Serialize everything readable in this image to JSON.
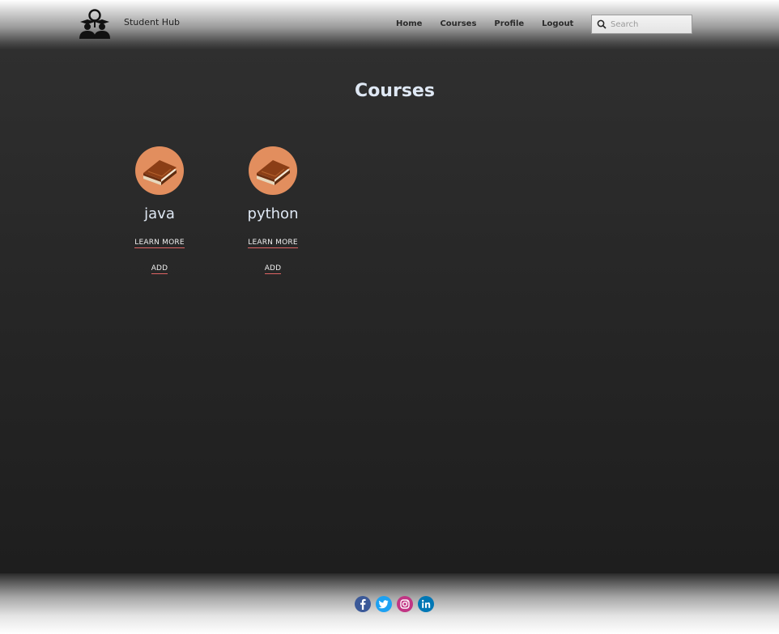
{
  "header": {
    "brand": "Student Hub",
    "nav": [
      "Home",
      "Courses",
      "Profile",
      "Logout"
    ],
    "search": {
      "placeholder": "Search",
      "value": ""
    }
  },
  "main": {
    "title": "Courses",
    "courses": [
      {
        "name": "java",
        "learn_more": "LEARN MORE",
        "add": "ADD",
        "icon": "book-icon"
      },
      {
        "name": "python",
        "learn_more": "LEARN MORE",
        "add": "ADD",
        "icon": "book-icon"
      }
    ]
  },
  "footer": {
    "socials": [
      "facebook-icon",
      "twitter-icon",
      "instagram-icon",
      "linkedin-icon"
    ]
  },
  "colors": {
    "accent_underline": "#e06565",
    "course_thumb": "#e28e5e",
    "title_text": "#dfe8f4"
  }
}
